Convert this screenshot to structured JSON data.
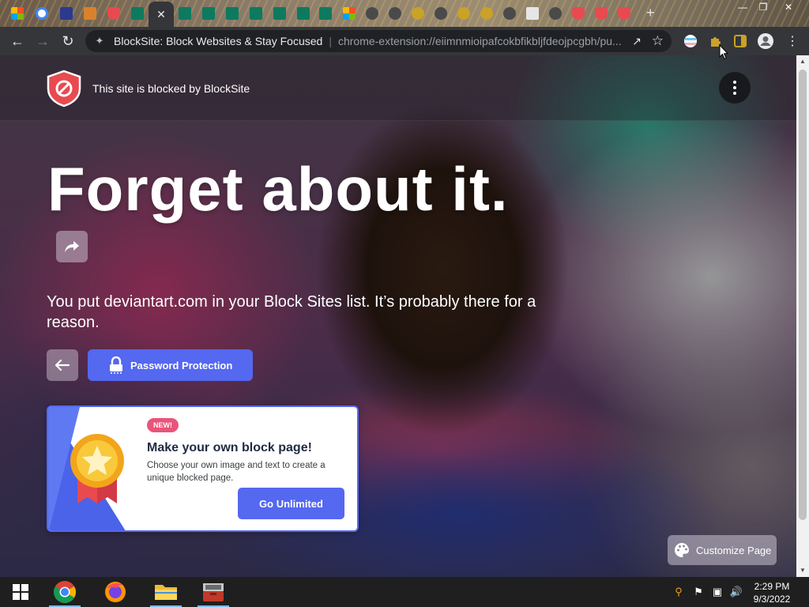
{
  "browser": {
    "tab_close": "✕",
    "new_tab": "+",
    "page_title": "BlockSite: Block Websites & Stay Focused",
    "separator": "|",
    "url": "chrome-extension://eiimnmioipafcokbfikbljfdeojpcgbh/pu..."
  },
  "page": {
    "blocked_by_text": "This site is blocked by BlockSite",
    "headline": "Forget about it.",
    "message": "You put deviantart.com in your Block Sites list. It’s probably there for a reason.",
    "password_button": "Password Protection",
    "customize_button": "Customize Page",
    "brand_color": "#5468f0",
    "shield_color": "#e84a4f"
  },
  "promo": {
    "badge": "NEW!",
    "title": "Make your own block page!",
    "description": "Choose your own image and text to create a unique blocked page.",
    "button": "Go Unlimited",
    "badge_color": "#e9547a"
  },
  "taskbar": {
    "apps": [
      "start-icon",
      "chrome-icon",
      "firefox-icon",
      "file-explorer-icon",
      "toolbox-app-icon"
    ],
    "time": "2:29 PM",
    "date": "9/3/2022"
  },
  "icons": [
    "back-arrow-icon",
    "forward-arrow-icon",
    "reload-icon",
    "extension-puzzle-icon",
    "share-icon",
    "bookmark-star-icon",
    "profile-avatar-icon",
    "kebab-menu-icon",
    "lock-icon",
    "medal-icon",
    "palette-icon"
  ]
}
